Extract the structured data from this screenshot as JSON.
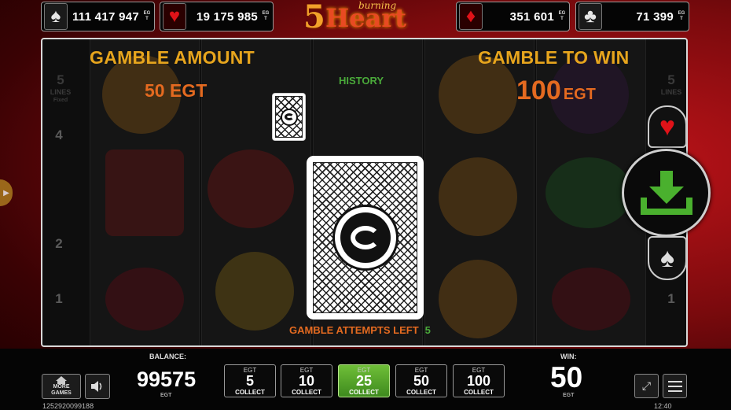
{
  "jackpots": [
    {
      "suit": "spade",
      "glyph": "♠",
      "value": "111 417 947",
      "currency": "EGT"
    },
    {
      "suit": "heart",
      "glyph": "♥",
      "value": "19 175 985",
      "currency": "EGT"
    },
    {
      "suit": "diamond",
      "glyph": "♦",
      "value": "351 601",
      "currency": "EGT"
    },
    {
      "suit": "club",
      "glyph": "♣",
      "value": "71 399",
      "currency": "EGT"
    }
  ],
  "logo": {
    "five": "5",
    "burning": "burning",
    "heart": "Heart"
  },
  "gamble": {
    "amount_title": "GAMBLE AMOUNT",
    "amount_value": "50 EGT",
    "to_win_title": "GAMBLE TO WIN",
    "to_win_value": "100",
    "to_win_currency": "EGT",
    "history_label": "HISTORY",
    "attempts_label": "GAMBLE ATTEMPTS LEFT",
    "attempts_value": "5"
  },
  "reels": {
    "left_lines_top": "5",
    "left_lines_word": "LINES",
    "left_lines_sub": "Fixed",
    "right_lines_top": "5",
    "right_lines_word": "LINES",
    "line_numbers": [
      "4",
      "2",
      "1"
    ]
  },
  "buttons": {
    "red_glyph": "♥",
    "black_glyph": "♠",
    "more_games": "MORE GAMES",
    "sound_icon": "speaker-icon",
    "fullscreen_glyph": "⤢"
  },
  "balance": {
    "label": "BALANCE:",
    "value": "99575",
    "currency": "EGT"
  },
  "stakes": [
    {
      "currency": "EGT",
      "value": "5",
      "action": "COLLECT",
      "active": false
    },
    {
      "currency": "EGT",
      "value": "10",
      "action": "COLLECT",
      "active": false
    },
    {
      "currency": "EGT",
      "value": "25",
      "action": "COLLECT",
      "active": true
    },
    {
      "currency": "EGT",
      "value": "50",
      "action": "COLLECT",
      "active": false
    },
    {
      "currency": "EGT",
      "value": "100",
      "action": "COLLECT",
      "active": false
    }
  ],
  "win": {
    "label": "WIN:",
    "value": "50",
    "currency": "EGT"
  },
  "footer": {
    "id": "1252920099188",
    "time": "12:40"
  },
  "colors": {
    "accent_gold": "#e7a51d",
    "accent_orange": "#e46a20",
    "accent_green": "#4aaa3a",
    "suit_red": "#e01218",
    "collect_green": "#6fbf38"
  }
}
